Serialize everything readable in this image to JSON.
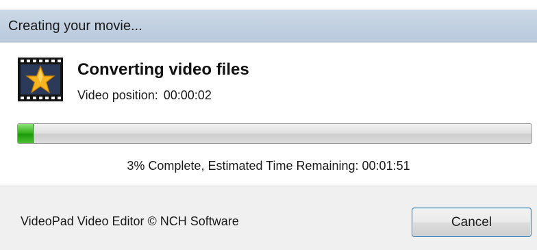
{
  "window": {
    "title": "Creating your movie..."
  },
  "dialog": {
    "app_icon": "videopad-film-star-icon",
    "heading": "Converting video files",
    "position_label": "Video position:",
    "position_value": "00:00:02",
    "progress_percent": 3,
    "progress_text": "3% Complete, Estimated Time Remaining: 00:01:51"
  },
  "footer": {
    "credit": "VideoPad Video Editor © NCH Software",
    "cancel_label": "Cancel"
  },
  "colors": {
    "title_bar": "#c3d2e3",
    "progress_green": "#37b31d",
    "button_border": "#3c7fb1"
  }
}
